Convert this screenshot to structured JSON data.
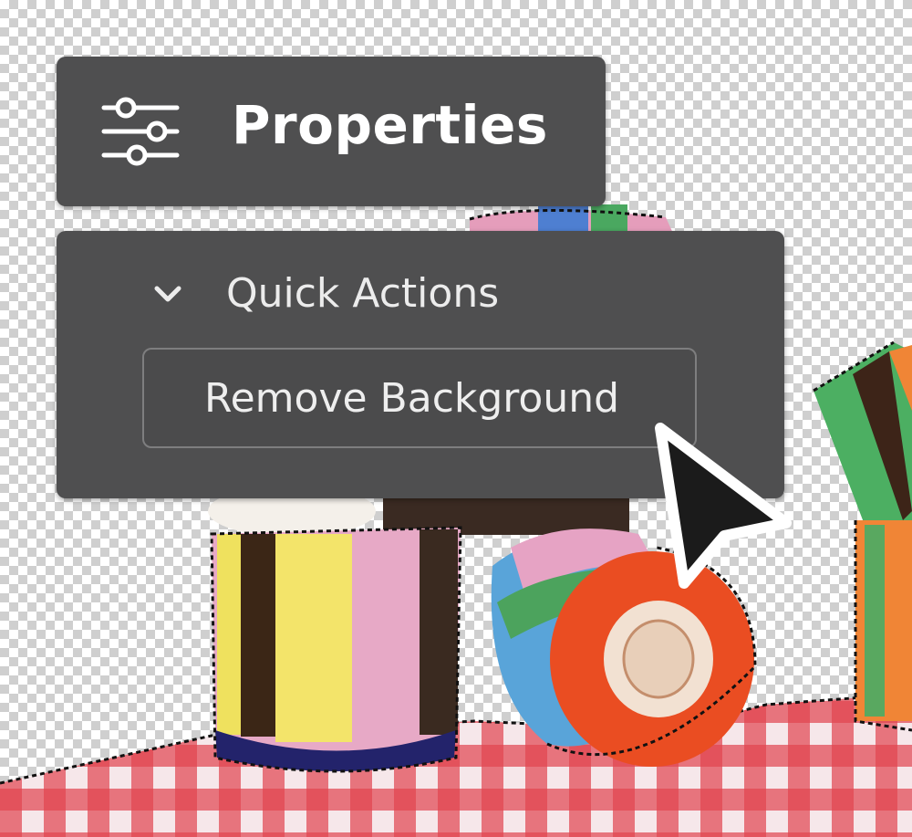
{
  "properties_panel": {
    "title": "Properties",
    "icon": "sliders-icon"
  },
  "quick_actions": {
    "title": "Quick Actions",
    "toggle_icon": "chevron-down-icon",
    "expanded": true,
    "button_label": "Remove Background"
  },
  "cursor": {
    "icon": "mouse-pointer-icon"
  },
  "colors": {
    "panel_bg": "#4f4f50",
    "text": "#ffffff",
    "button_border": "#7e7e7f",
    "cursor_fill": "#1b1b1b"
  }
}
